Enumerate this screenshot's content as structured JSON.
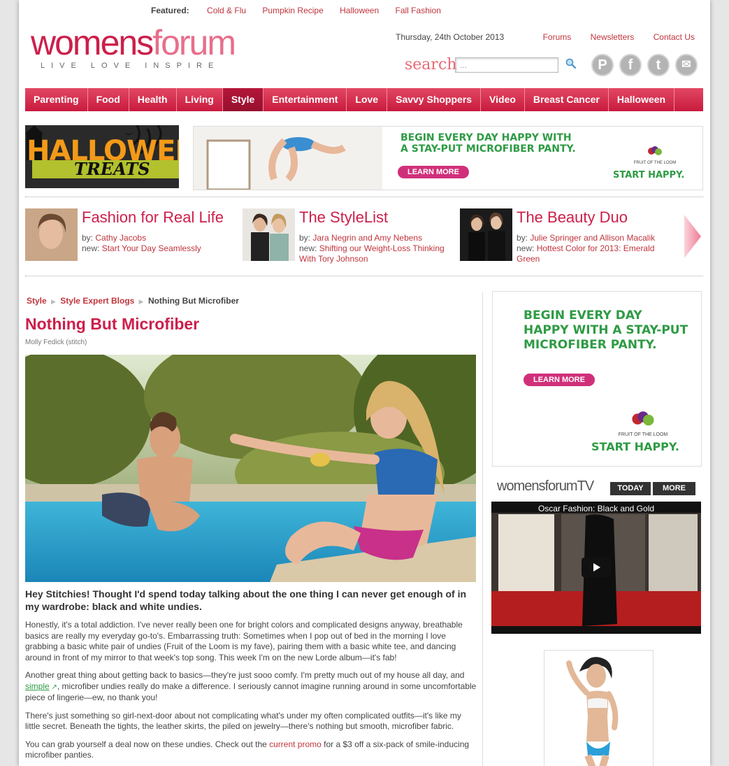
{
  "featured": {
    "label": "Featured:",
    "links": [
      "Cold & Flu",
      "Pumpkin Recipe",
      "Halloween",
      "Fall Fashion"
    ]
  },
  "logo": {
    "word_a": "womens",
    "word_b": "forum",
    "tagline": "LIVE  LOVE  INSPIRE"
  },
  "header": {
    "date": "Thursday, 24th October 2013",
    "links": [
      "Forums",
      "Newsletters",
      "Contact Us"
    ],
    "search_label": "search",
    "search_placeholder": "..."
  },
  "social": {
    "pinterest": "P",
    "facebook": "f",
    "twitter": "t",
    "email": "✉"
  },
  "nav": {
    "items": [
      "Parenting",
      "Food",
      "Health",
      "Living",
      "Style",
      "Entertainment",
      "Love",
      "Savvy Shoppers",
      "Video",
      "Breast Cancer",
      "Halloween"
    ],
    "active": "Style"
  },
  "halloween_banner": {
    "line1": "HALLOWEEN",
    "line2": "TREATS"
  },
  "ad_top": {
    "headline1": "BEGIN EVERY DAY HAPPY WITH",
    "headline2": "A STAY-PUT MICROFIBER PANTY.",
    "cta": "LEARN MORE",
    "brand": "FRUIT OF THE LOOM",
    "slogan": "START HAPPY."
  },
  "experts": [
    {
      "name": "Fashion for Real Life",
      "by_label": "by:",
      "by": "Cathy Jacobs",
      "new_label": "new:",
      "new": "Start Your Day Seamlessly"
    },
    {
      "name": "The StyleList",
      "by_label": "by:",
      "by": "Jara Negrin and Amy Nebens",
      "new_label": "new:",
      "new": "Shifting our Weight-Loss Thinking With Tory Johnson"
    },
    {
      "name": "The Beauty Duo",
      "by_label": "by:",
      "by": "Julie Springer and Allison Macalik",
      "new_label": "new:",
      "new": "Hottest Color for 2013: Emerald Green"
    }
  ],
  "breadcrumb": {
    "items": [
      "Style",
      "Style Expert Blogs"
    ],
    "current": "Nothing But Microfiber"
  },
  "article": {
    "title": "Nothing But Microfiber",
    "author": "Molly Fedick (stitch)",
    "lead": "Hey Stitchies! Thought I'd spend today talking about the one thing I can never get enough of in my wardrobe: black and white undies.",
    "p1": "Honestly, it's a total addiction. I've never really been one for bright colors and complicated designs anyway, breathable basics are really my everyday go-to's. Embarrassing truth: Sometimes when I pop out of bed in the morning I love grabbing a basic white pair of undies (Fruit of the Loom is my fave), pairing them with a basic white tee, and dancing around in front of my mirror to that week's top song. This week I'm on the new Lorde album—it's fab!",
    "p2_a": "Another great thing about getting back to basics—they're just sooo comfy. I'm pretty much out of my house all day, and ",
    "p2_link": "simple",
    "p2_b": ", microfiber undies really do make a difference. I seriously cannot imagine running around in some uncomfortable piece of lingerie—ew, no thank you!",
    "p3": "There's just something so girl-next-door about not complicating what's under my often complicated outfits—it's like my little secret. Beneath the tights, the leather skirts, the piled on jewelry—there's nothing but smooth, microfiber fabric.",
    "p4_a": "You can grab yourself a deal now on these undies. Check out the ",
    "p4_link": "current promo",
    "p4_b": " for a $3 off a six-pack of smile-inducing microfiber panties."
  },
  "ad_side": {
    "l1": "BEGIN EVERY DAY",
    "l2": "HAPPY WITH A STAY-PUT",
    "l3": "MICROFIBER PANTY.",
    "cta": "LEARN MORE",
    "brand": "FRUIT OF THE LOOM",
    "slogan": "START HAPPY."
  },
  "tv": {
    "logo": "womensforumTV",
    "tab_today": "TODAY",
    "tab_more": "MORE",
    "video_title": "Oscar Fashion: Black and Gold"
  }
}
